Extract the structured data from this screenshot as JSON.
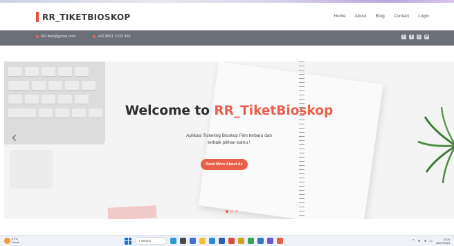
{
  "brand": {
    "name": "RR_TIKETBIOSKOP"
  },
  "nav": {
    "items": [
      "Home",
      "About",
      "Blog",
      "Contact",
      "Login"
    ]
  },
  "info": {
    "email": "RR tiket@gmail.com",
    "phone": "+62 8561 2233 456"
  },
  "social": [
    "twitter-icon",
    "facebook-icon",
    "instagram-icon",
    "linkedin-icon"
  ],
  "hero": {
    "title_prefix": "Welcome to ",
    "title_accent": "RR_TiketBioskop",
    "subtitle_line1": "Aplikasi Ticketing Bioskop Film terbaru dan",
    "subtitle_line2": "terbaik pilihan kamu !",
    "button_label": "Read More About As",
    "slide_count": 3,
    "active_slide": 1
  },
  "taskbar": {
    "temperature": "27°C",
    "weather_desc": "Cerah",
    "search_placeholder": "Search",
    "time": "13:24",
    "date": "26/07/2024"
  },
  "colors": {
    "accent": "#e8604c",
    "infobar": "#6b6f78",
    "heading": "#2e2e2e"
  }
}
